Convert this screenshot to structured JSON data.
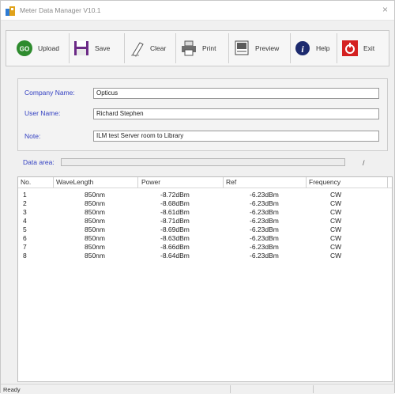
{
  "window": {
    "title": "Meter Data Manager V10.1",
    "close_glyph": "×"
  },
  "toolbar": {
    "upload": "Upload",
    "save": "Save",
    "clear": "Clear",
    "print": "Print",
    "preview": "Preview",
    "help": "Help",
    "exit": "Exit"
  },
  "form": {
    "company_label": "Company Name:",
    "company_value": "Opticus",
    "user_label": "User Name:",
    "user_value": "Richard Stephen",
    "note_label": "Note:",
    "note_value": "ILM test Server room to Library"
  },
  "data_area": {
    "label": "Data area:",
    "trailing": "/"
  },
  "table": {
    "headers": [
      "No.",
      "WaveLength",
      "Power",
      "Ref",
      "Frequency"
    ],
    "rows": [
      [
        "1",
        "850nm",
        "-8.72dBm",
        "-6.23dBm",
        "CW"
      ],
      [
        "2",
        "850nm",
        "-8.68dBm",
        "-6.23dBm",
        "CW"
      ],
      [
        "3",
        "850nm",
        "-8.61dBm",
        "-6.23dBm",
        "CW"
      ],
      [
        "4",
        "850nm",
        "-8.71dBm",
        "-6.23dBm",
        "CW"
      ],
      [
        "5",
        "850nm",
        "-8.69dBm",
        "-6.23dBm",
        "CW"
      ],
      [
        "6",
        "850nm",
        "-8.63dBm",
        "-6.23dBm",
        "CW"
      ],
      [
        "7",
        "850nm",
        "-8.66dBm",
        "-6.23dBm",
        "CW"
      ],
      [
        "8",
        "850nm",
        "-8.64dBm",
        "-6.23dBm",
        "CW"
      ]
    ]
  },
  "status": {
    "text": "Ready"
  },
  "icons": {
    "upload": "go-icon",
    "save": "floppy-icon",
    "clear": "eraser-icon",
    "print": "printer-icon",
    "preview": "preview-icon",
    "help": "info-icon",
    "exit": "power-icon"
  },
  "colors": {
    "label_blue": "#3340c2",
    "go_green": "#2e8b2e",
    "exit_red": "#d42020",
    "help_navy": "#1c2a6e"
  }
}
